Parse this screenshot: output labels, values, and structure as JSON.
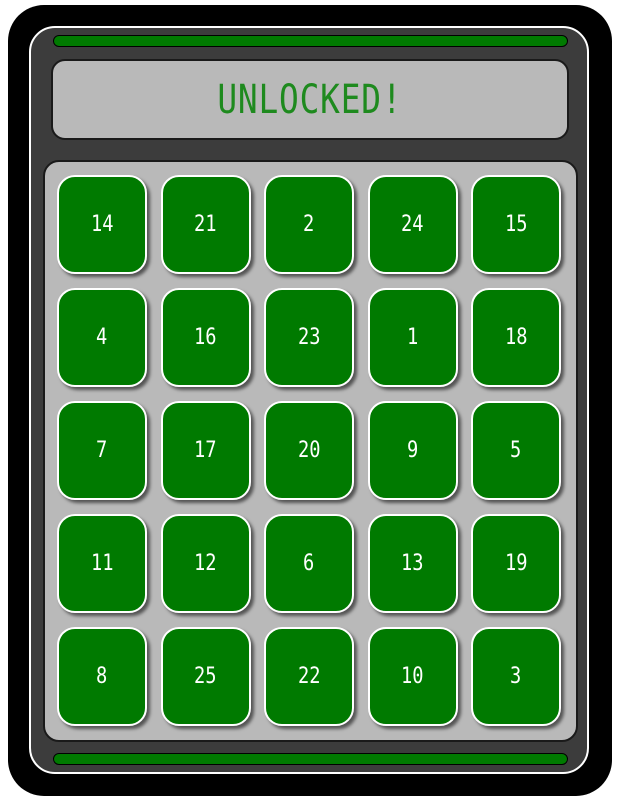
{
  "display": {
    "message": "UNLOCKED!"
  },
  "colors": {
    "tile_fill": "#007a00",
    "display_text": "#1e8a1e",
    "panel": "#b9b9b9",
    "body": "#3c3c3c"
  },
  "tiles": [
    "14",
    "21",
    "2",
    "24",
    "15",
    "4",
    "16",
    "23",
    "1",
    "18",
    "7",
    "17",
    "20",
    "9",
    "5",
    "11",
    "12",
    "6",
    "13",
    "19",
    "8",
    "25",
    "22",
    "10",
    "3"
  ]
}
